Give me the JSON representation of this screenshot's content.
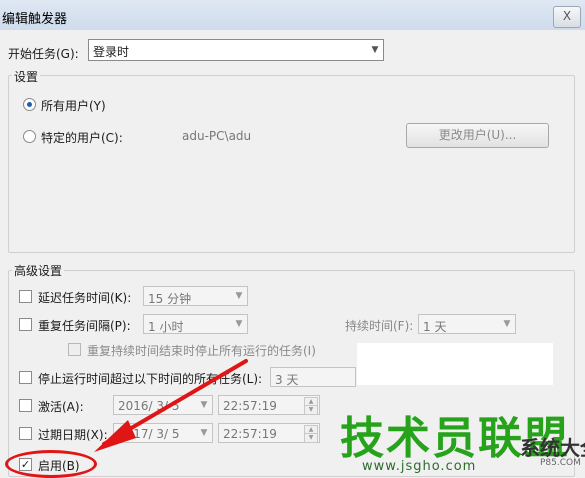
{
  "window": {
    "title": "编辑触发器",
    "close_label": "X"
  },
  "start_task": {
    "label": "开始任务(G):",
    "value": "登录时"
  },
  "settings": {
    "group_title": "设置",
    "all_users": {
      "label": "所有用户(Y)",
      "checked": true
    },
    "specific_user": {
      "label": "特定的用户(C):",
      "checked": false,
      "value": "adu-PC\\adu"
    },
    "change_user_button": "更改用户(U)..."
  },
  "advanced": {
    "group_title": "高级设置",
    "delay": {
      "label": "延迟任务时间(K):",
      "value": "15 分钟",
      "checked": false
    },
    "repeat": {
      "label": "重复任务间隔(P):",
      "value": "1 小时",
      "checked": false,
      "duration_label": "持续时间(F):",
      "duration_value": "1 天"
    },
    "stop_repeat": {
      "label": "重复持续时间结束时停止所有运行的任务(I)",
      "checked": false
    },
    "stop_running": {
      "label": "停止运行时间超过以下时间的所有任务(L):",
      "value": "3 天",
      "checked": false
    },
    "activate": {
      "label": "激活(A):",
      "date": "2016/ 3/ 5",
      "time": "22:57:19",
      "checked": false
    },
    "expire": {
      "label": "过期日期(X):",
      "date": "2017/ 3/ 5",
      "time": "22:57:19",
      "checked": false
    },
    "enabled": {
      "label": "启用(B)",
      "checked": true
    }
  },
  "watermark": {
    "text": "技术员联盟",
    "url": "www.jsgho.com",
    "side": "系统大全",
    "small": "P85.COM"
  },
  "colors": {
    "annotation": "#e01515",
    "watermark": "#27a31b"
  }
}
